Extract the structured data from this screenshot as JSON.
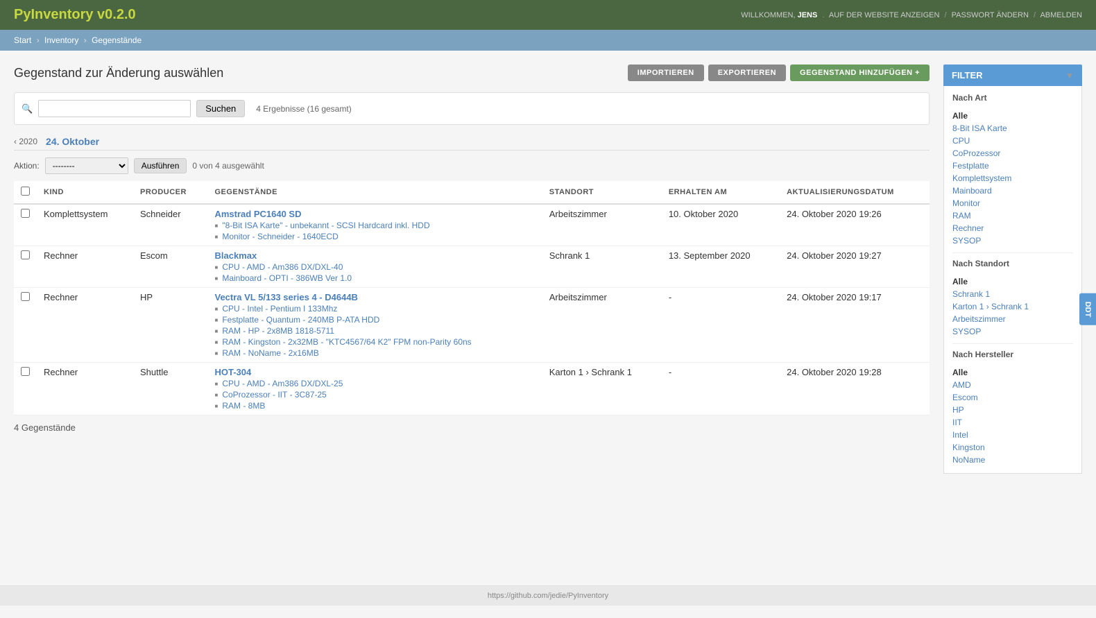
{
  "app": {
    "title": "PyInventory v0.2.0",
    "nav": {
      "welcome_prefix": "WILLKOMMEN,",
      "username": "JENS",
      "links": [
        {
          "label": "AUF DER WEBSITE ANZEIGEN"
        },
        {
          "label": "PASSWORT ÄNDERN"
        },
        {
          "label": "ABMELDEN"
        }
      ]
    }
  },
  "breadcrumb": {
    "items": [
      "Start",
      "Inventory",
      "Gegenstände"
    ]
  },
  "page": {
    "title": "Gegenstand zur Änderung auswählen",
    "buttons": {
      "import": "IMPORTIEREN",
      "export": "EXPORTIEREN",
      "add": "GEGENSTAND HINZUFÜGEN +"
    }
  },
  "search": {
    "placeholder": "",
    "button_label": "Suchen",
    "result_text": "4 Ergebnisse (16 gesamt)"
  },
  "date_nav": {
    "year": "‹ 2020",
    "active_date": "24. Oktober"
  },
  "action": {
    "label": "Aktion:",
    "default_option": "--------",
    "button_label": "Ausführen",
    "selected_text": "0 von 4 ausgewählt"
  },
  "table": {
    "headers": [
      "",
      "KIND",
      "PRODUCER",
      "GEGENSTÄNDE",
      "STANDORT",
      "ERHALTEN AM",
      "AKTUALISIERUNGSDATUM"
    ],
    "rows": [
      {
        "kind": "Komplettsystem",
        "producer": "Schneider",
        "name": "Amstrad PC1640 SD",
        "sub_items": [
          "\"8-Bit ISA Karte\" - unbekannt - SCSI Hardcard inkl. HDD",
          "Monitor - Schneider - 1640ECD"
        ],
        "standort": "Arbeitszimmer",
        "erhalten": "10. Oktober 2020",
        "aktualisiert": "24. Oktober 2020 19:26"
      },
      {
        "kind": "Rechner",
        "producer": "Escom",
        "name": "Blackmax",
        "sub_items": [
          "CPU - AMD - Am386 DX/DXL-40",
          "Mainboard - OPTI - 386WB Ver 1.0"
        ],
        "standort": "Schrank 1",
        "erhalten": "13. September 2020",
        "aktualisiert": "24. Oktober 2020 19:27"
      },
      {
        "kind": "Rechner",
        "producer": "HP",
        "name": "Vectra VL 5/133 series 4 - D4644B",
        "sub_items": [
          "CPU - Intel - Pentium I 133Mhz",
          "Festplatte - Quantum - 240MB P-ATA HDD",
          "RAM - HP - 2x8MB 1818-5711",
          "RAM - Kingston - 2x32MB - \"KTC4567/64 K2\" FPM non-Parity 60ns",
          "RAM - NoName - 2x16MB"
        ],
        "standort": "Arbeitszimmer",
        "erhalten": "-",
        "aktualisiert": "24. Oktober 2020 19:17"
      },
      {
        "kind": "Rechner",
        "producer": "Shuttle",
        "name": "HOT-304",
        "sub_items": [
          "CPU - AMD - Am386 DX/DXL-25",
          "CoProzessor - IIT - 3C87-25",
          "RAM - 8MB"
        ],
        "standort": "Karton 1 › Schrank 1",
        "erhalten": "-",
        "aktualisiert": "24. Oktober 2020 19:28"
      }
    ]
  },
  "item_count_text": "4 Gegenstände",
  "filter": {
    "header": "FILTER",
    "nach_art": {
      "title": "Nach Art",
      "items": [
        "Alle",
        "8-Bit ISA Karte",
        "CPU",
        "CoProzessor",
        "Festplatte",
        "Komplettsystem",
        "Mainboard",
        "Monitor",
        "RAM",
        "Rechner",
        "SYSOP"
      ]
    },
    "nach_standort": {
      "title": "Nach Standort",
      "items": [
        "Alle",
        "Schrank 1",
        "Karton 1 › Schrank 1",
        "Arbeitszimmer",
        "SYSOP"
      ]
    },
    "nach_hersteller": {
      "title": "Nach Hersteller",
      "items": [
        "Alle",
        "AMD",
        "Escom",
        "HP",
        "IIT",
        "Intel",
        "Kingston",
        "NoName"
      ]
    }
  },
  "side_tab": "DDT",
  "footer": {
    "link": "https://github.com/jedie/PyInventory"
  }
}
